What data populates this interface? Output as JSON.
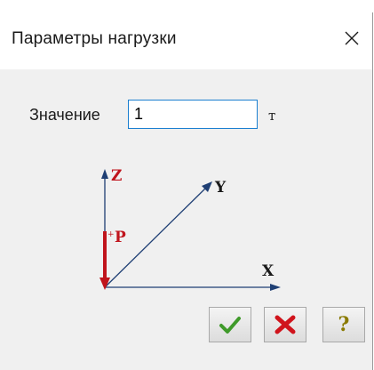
{
  "dialog": {
    "title": "Параметры  нагрузки",
    "close_icon": "close-icon"
  },
  "form": {
    "value_label": "Значение",
    "value_input": "1",
    "unit": "т"
  },
  "diagram": {
    "axis_z": "Z",
    "axis_y": "Y",
    "axis_x": "X",
    "load_label": "P",
    "load_color": "#c0141c",
    "axis_color": "#1f3f74"
  },
  "buttons": {
    "ok_icon": "checkmark-icon",
    "cancel_icon": "cross-icon",
    "help_glyph": "?"
  }
}
